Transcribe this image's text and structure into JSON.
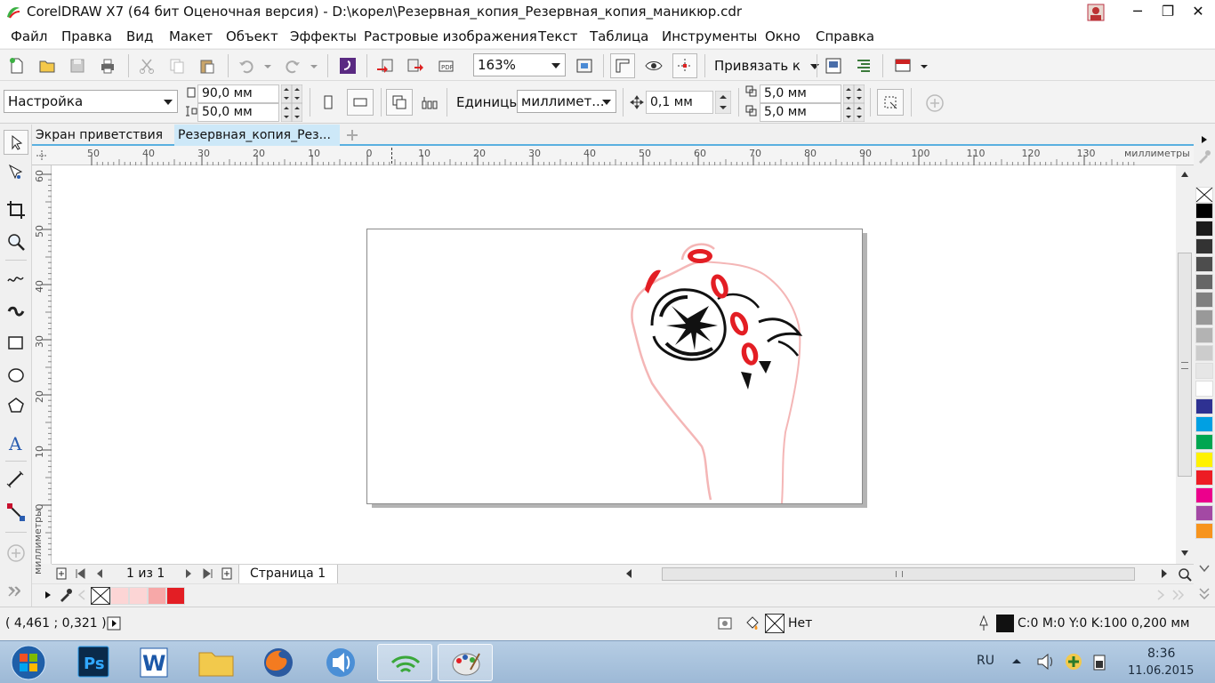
{
  "window": {
    "title": "CorelDRAW X7 (64 бит Оценочная версия) - D:\\корел\\Резервная_копия_Резервная_копия_маникюр.cdr",
    "minimize": "─",
    "maximize": "❐",
    "close": "✕"
  },
  "menu": [
    "Файл",
    "Правка",
    "Вид",
    "Макет",
    "Объект",
    "Эффекты",
    "Растровые изображения",
    "Текст",
    "Таблица",
    "Инструменты",
    "Окно",
    "Справка"
  ],
  "toolbar": {
    "zoom": "163%",
    "snap_label": "Привязать к"
  },
  "properties": {
    "preset": "Настройка",
    "width": "90,0 мм",
    "height": "50,0 мм",
    "units_label": "Единицы:",
    "units_value": "миллимет...",
    "nudge": "0,1 мм",
    "dup_x": "5,0 мм",
    "dup_y": "5,0 мм"
  },
  "tabs": [
    "Экран приветствия",
    "Резервная_копия_Рез..."
  ],
  "rulers": {
    "unit": "миллиметры",
    "h_ticks": [
      "50",
      "40",
      "30",
      "20",
      "10",
      "0",
      "10",
      "20",
      "30",
      "40",
      "50",
      "60",
      "70",
      "80",
      "90",
      "100",
      "110",
      "120",
      "130"
    ],
    "v_ticks": [
      "60",
      "50",
      "40",
      "30",
      "20",
      "10",
      "0"
    ]
  },
  "pagenav": {
    "count": "1 из 1",
    "page_tab": "Страница 1"
  },
  "status": {
    "coords": "( 4,461 ; 0,321 )",
    "fill": "Нет",
    "outline": "C:0 M:0 Y:0 K:100  0,200 мм"
  },
  "palette_colors": [
    "#000000",
    "#1a1a1a",
    "#333333",
    "#4d4d4d",
    "#666666",
    "#808080",
    "#999999",
    "#b3b3b3",
    "#cccccc",
    "#e6e6e6",
    "#ffffff",
    "#2e3192",
    "#00a0e3",
    "#00a651",
    "#fff200",
    "#ed1c24",
    "#ec008c",
    "#a349a4",
    "#f7941d"
  ],
  "doc_palette_colors": [
    "#fcd5d5",
    "#fcd5d5",
    "#f7a8a8",
    "#e31e24"
  ],
  "taskbar": {
    "lang": "RU",
    "time": "8:36",
    "date": "11.06.2015"
  }
}
